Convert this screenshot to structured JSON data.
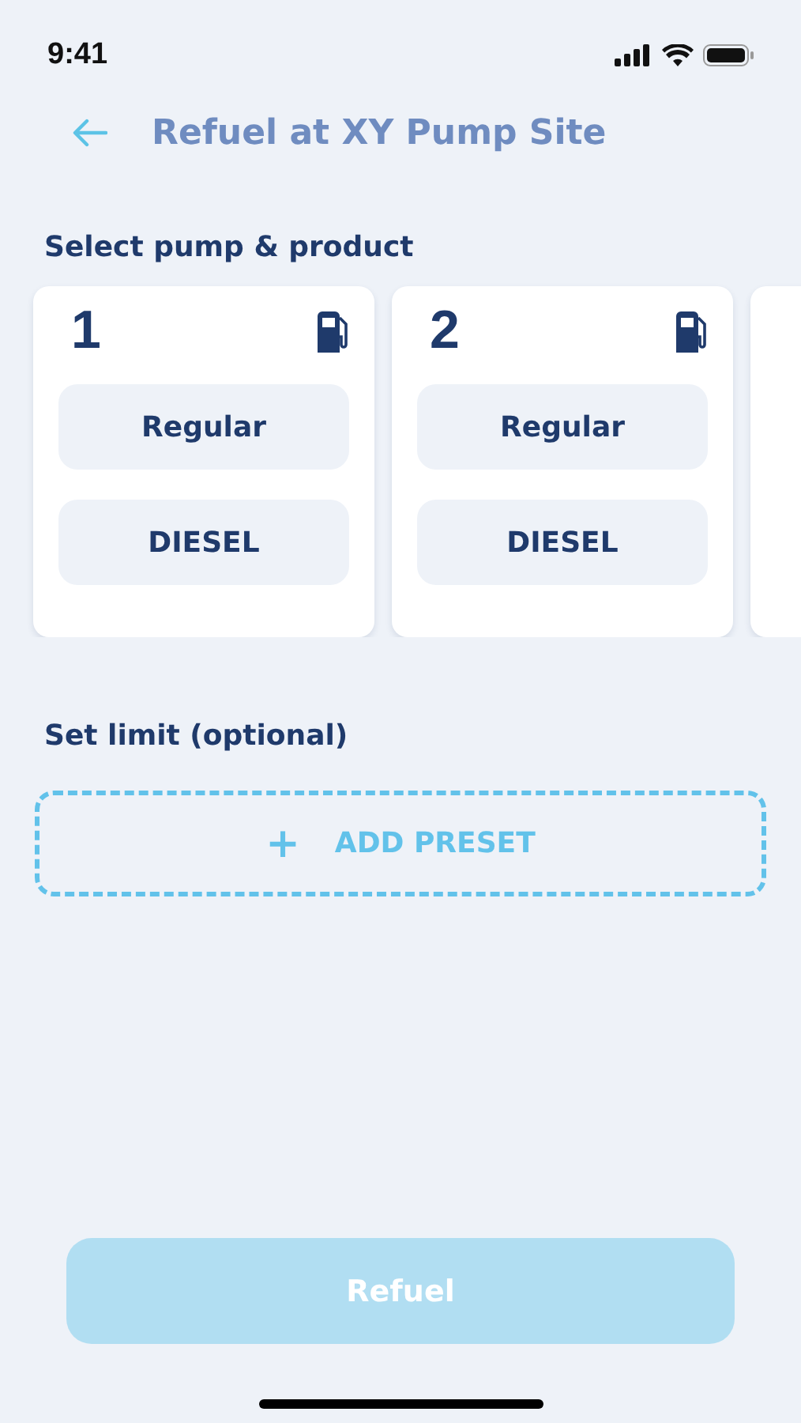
{
  "status_bar": {
    "time": "9:41"
  },
  "header": {
    "title": "Refuel at XY Pump Site"
  },
  "pump_section": {
    "title": "Select pump & product",
    "pumps": [
      {
        "number": "1",
        "products": [
          {
            "label": "Regular",
            "selected": false
          },
          {
            "label": "DIESEL",
            "selected": false
          }
        ]
      },
      {
        "number": "2",
        "products": [
          {
            "label": "Regular",
            "selected": false
          },
          {
            "label": "DIESEL",
            "selected": false
          }
        ]
      }
    ],
    "more_pumps": true
  },
  "limit_section": {
    "title": "Set limit (optional)",
    "add_button": {
      "icon": "+",
      "label": "ADD PRESET"
    }
  },
  "refuel_button": {
    "label": "Refuel",
    "disabled": true
  }
}
